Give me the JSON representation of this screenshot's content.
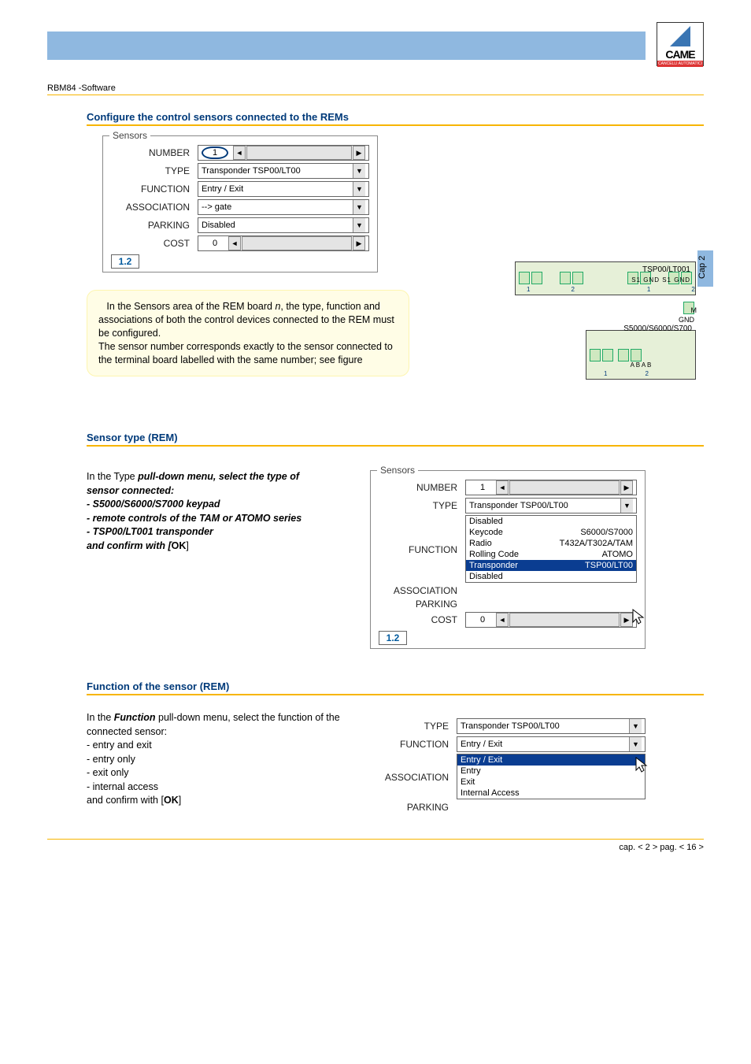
{
  "header": {
    "breadcrumb": "RBM84 -Software",
    "logo": "CAME",
    "logo_sub": "CANCELLI AUTOMATICI"
  },
  "cap_tab": "Cap 2",
  "section1": {
    "title": "Configure the control sensors connected to the REMs",
    "panel": {
      "legend": "Sensors",
      "number_label": "NUMBER",
      "number_value": "1",
      "type_label": "TYPE",
      "type_value": "Transponder TSP00/LT00",
      "function_label": "FUNCTION",
      "function_value": "Entry / Exit",
      "association_label": "ASSOCIATION",
      "association_value": "--> gate",
      "parking_label": "PARKING",
      "parking_value": "Disabled",
      "cost_label": "COST",
      "cost_value": "0",
      "tab": "1.2"
    },
    "note": "In the Sensors area of the REM board n, the type, function and associations of both the control devices connected to the REM must be configured. The sensor number corresponds exactly to the sensor connected to the terminal board labelled with the same number; see figure",
    "diagram": {
      "block1_title": "TSP00/LT001",
      "block1_terms": "S1  GND S1  GND",
      "block1_nums": [
        "1",
        "2",
        "1",
        "2"
      ],
      "block1_side": "M",
      "block1_side2": "GND",
      "block2_title": "S5000/S6000/S700",
      "block2_terms": "A    B    A    B",
      "block2_nums": [
        "1",
        "2"
      ]
    }
  },
  "section2": {
    "title": "Sensor type (REM)",
    "text_intro": "In the  Type ",
    "text_bold1": "pull-down menu, select the type of",
    "text_bold2": "sensor connected:",
    "bullets": [
      "- S5000/S6000/S7000 keypad",
      "- remote controls of the TAM or ATOMO series",
      "- TSP00/LT001 transponder"
    ],
    "text_confirm": "and confirm with [",
    "text_ok": "OK",
    "text_confirm_end": "]",
    "panel": {
      "legend": "Sensors",
      "number_label": "NUMBER",
      "number_value": "1",
      "type_label": "TYPE",
      "type_value": "Transponder  TSP00/LT00",
      "function_label": "FUNCTION",
      "association_label": "ASSOCIATION",
      "parking_label": "PARKING",
      "cost_label": "COST",
      "cost_value": "0",
      "tab": "1.2",
      "dropdown": [
        {
          "l": "Disabled",
          "r": ""
        },
        {
          "l": "Keycode",
          "r": "S6000/S7000"
        },
        {
          "l": "Radio",
          "r": "T432A/T302A/TAM"
        },
        {
          "l": "Rolling Code",
          "r": "ATOMO"
        },
        {
          "l": "Transponder",
          "r": "TSP00/LT00",
          "sel": true
        },
        {
          "l": "Disabled",
          "r": ""
        }
      ]
    }
  },
  "section3": {
    "title": "Function of the sensor (REM)",
    "text1": "In the ",
    "text_bold": "Function",
    "text2": " pull-down menu, select the function of the connected sensor:",
    "bullets": [
      "- entry and exit",
      "- entry only",
      "- exit only",
      "- internal access"
    ],
    "text_confirm": "and confirm with [",
    "text_ok": "OK",
    "text_confirm_end": "]",
    "panel": {
      "type_label": "TYPE",
      "type_value": "Transponder  TSP00/LT00",
      "function_label": "FUNCTION",
      "function_value": "Entry / Exit",
      "association_label": "ASSOCIATION",
      "parking_label": "PARKING",
      "dropdown": [
        {
          "l": "Entry / Exit",
          "sel": true
        },
        {
          "l": "Entry"
        },
        {
          "l": "Exit"
        },
        {
          "l": "Internal Access"
        }
      ]
    }
  },
  "footer": "cap. < 2 > pag. < 16 >"
}
